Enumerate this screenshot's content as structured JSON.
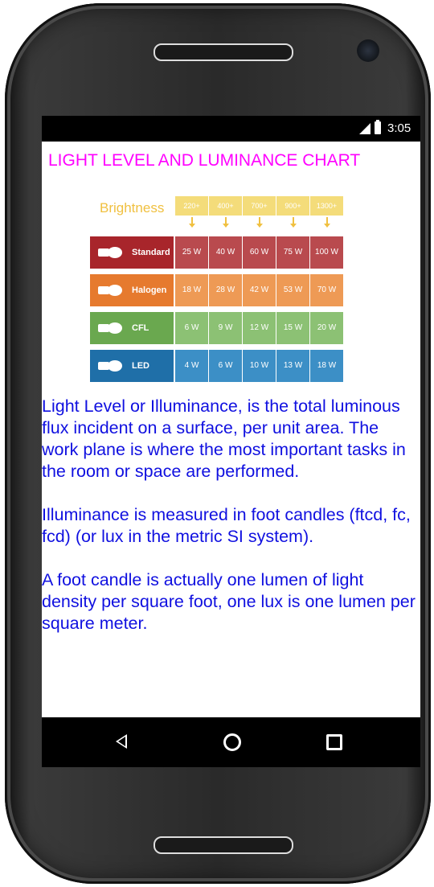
{
  "status_bar": {
    "time": "3:05"
  },
  "app": {
    "title": "LIGHT LEVEL AND LUMINANCE CHART"
  },
  "chart_data": {
    "type": "table",
    "brightness_label": "Brightness",
    "brightness_levels": [
      "220+",
      "400+",
      "700+",
      "900+",
      "1300+"
    ],
    "rows": [
      {
        "name": "Standard",
        "color": "#a8252b",
        "cell_color": "#b94a4e",
        "values": [
          "25 W",
          "40 W",
          "60 W",
          "75 W",
          "100 W"
        ]
      },
      {
        "name": "Halogen",
        "color": "#e67a2e",
        "cell_color": "#ee9a55",
        "values": [
          "18 W",
          "28 W",
          "42 W",
          "53 W",
          "70 W"
        ]
      },
      {
        "name": "CFL",
        "color": "#6aa84f",
        "cell_color": "#8cc174",
        "values": [
          "6 W",
          "9 W",
          "12 W",
          "15 W",
          "20 W"
        ]
      },
      {
        "name": "LED",
        "color": "#1f6fa8",
        "cell_color": "#3c8fc6",
        "values": [
          "4 W",
          "6 W",
          "10 W",
          "13 W",
          "18 W"
        ]
      }
    ]
  },
  "description": {
    "p1": "Light Level or Illuminance, is the total luminous flux incident on a surface, per unit area. The work plane is where the most important tasks in the room or space are performed.",
    "p2": " Illuminance is measured in foot candles (ftcd, fc, fcd) (or lux in the metric SI system).",
    "p3": " A foot candle is actually one lumen of light density per square foot, one lux is one lumen per square meter."
  },
  "colors": {
    "title": "#ff00ff",
    "body_text": "#1010e0",
    "brightness": "#f4dc7a"
  },
  "icons": {
    "back": "back-triangle-icon",
    "home": "home-circle-icon",
    "recents": "recents-square-icon"
  }
}
